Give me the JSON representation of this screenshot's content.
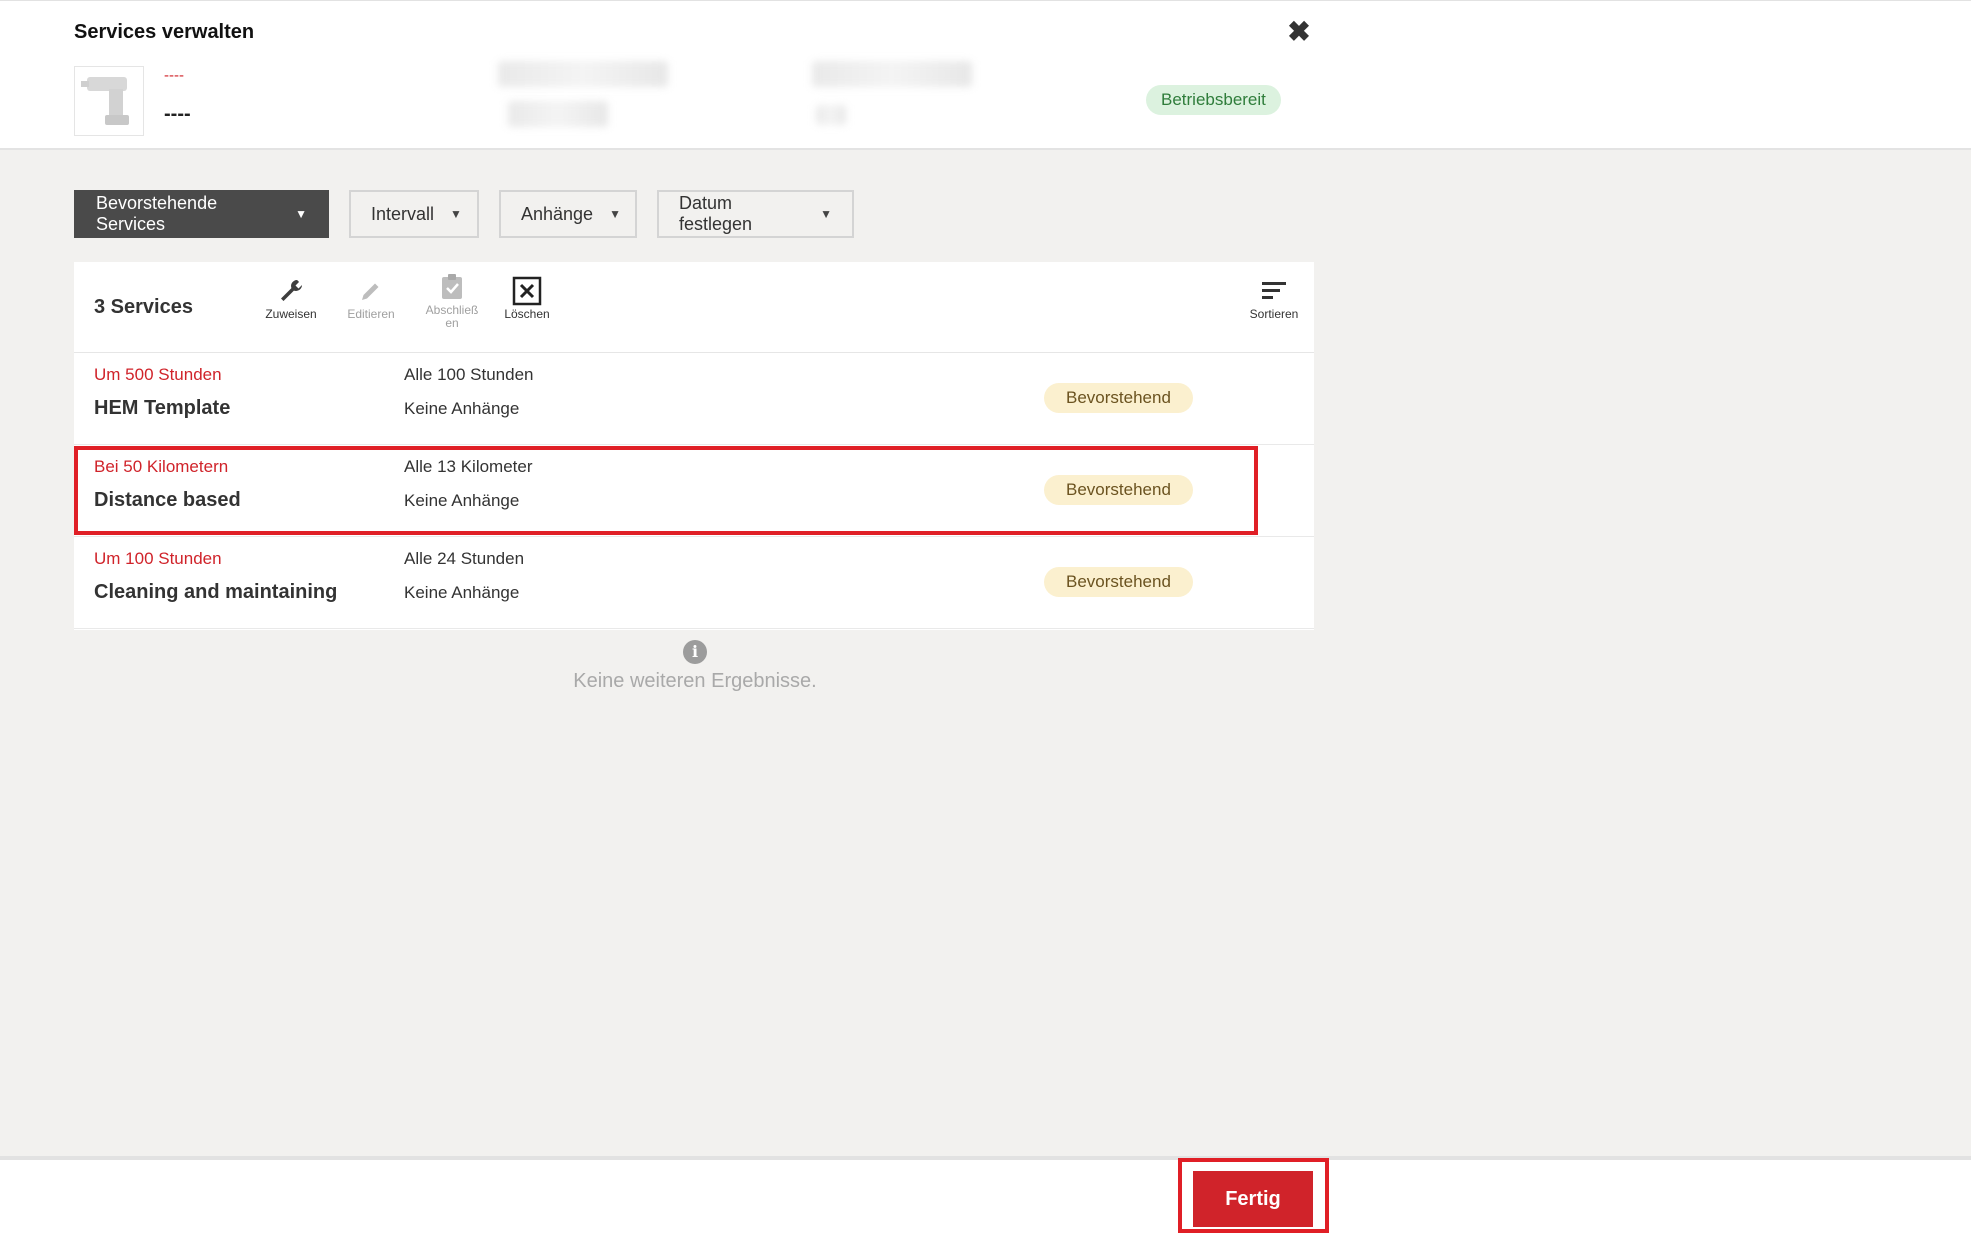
{
  "header": {
    "title": "Services verwalten",
    "asset_code": "----",
    "asset_name": "----",
    "status": "Betriebsbereit"
  },
  "filters": {
    "upcoming": "Bevorstehende Services",
    "interval": "Intervall",
    "attachments": "Anhänge",
    "date": "Datum festlegen"
  },
  "toolbar": {
    "count": "3 Services",
    "assign": "Zuweisen",
    "edit": "Editieren",
    "complete": "Abschließen",
    "delete": "Löschen",
    "sort": "Sortieren"
  },
  "services": [
    {
      "due": "Um 500 Stunden",
      "name": "HEM Template",
      "interval": "Alle 100 Stunden",
      "attachments": "Keine Anhänge",
      "status": "Bevorstehend"
    },
    {
      "due": "Bei 50 Kilometern",
      "name": "Distance based",
      "interval": "Alle 13 Kilometer",
      "attachments": "Keine Anhänge",
      "status": "Bevorstehend"
    },
    {
      "due": "Um 100 Stunden",
      "name": "Cleaning and maintaining",
      "interval": "Alle 24 Stunden",
      "attachments": "Keine Anhänge",
      "status": "Bevorstehend"
    }
  ],
  "no_more_results": "Keine weiteren Ergebnisse.",
  "footer": {
    "done": "Fertig"
  },
  "colors": {
    "accent": "#d0232a",
    "highlight": "#e01f26"
  }
}
